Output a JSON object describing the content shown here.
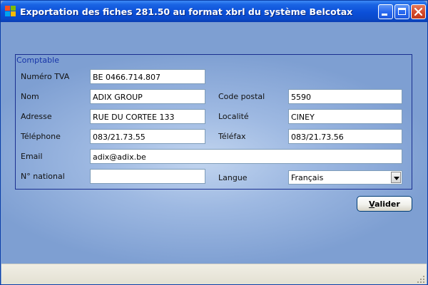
{
  "window": {
    "title": "Exportation des fiches 281.50 au format xbrl du système Belcotax",
    "icons": {
      "app": "windows-app-icon",
      "minimize": "minimize-icon",
      "maximize": "maximize-icon",
      "close": "close-icon"
    }
  },
  "group": {
    "title": "Comptable",
    "fields": {
      "tva": {
        "label": "Numéro TVA",
        "value": "BE 0466.714.807"
      },
      "nom": {
        "label": "Nom",
        "value": "ADIX GROUP"
      },
      "code_postal": {
        "label": "Code postal",
        "value": "5590"
      },
      "adresse": {
        "label": "Adresse",
        "value": "RUE DU CORTEE 133"
      },
      "localite": {
        "label": "Localité",
        "value": "CINEY"
      },
      "telephone": {
        "label": "Téléphone",
        "value": "083/21.73.55"
      },
      "telefax": {
        "label": "Téléfax",
        "value": "083/21.73.56"
      },
      "email": {
        "label": "Email",
        "value": "adix@adix.be"
      },
      "national": {
        "label": "N° national",
        "value": ""
      },
      "langue": {
        "label": "Langue",
        "value": "Français"
      }
    }
  },
  "button": {
    "valider_mnemonic": "V",
    "valider_rest": "alider"
  },
  "colors": {
    "title_bar": "#0b4fd8",
    "client_background": "#9eb9e2",
    "group_border": "#1a2f90",
    "group_title": "#1634a8",
    "close_button": "#d4492a"
  }
}
